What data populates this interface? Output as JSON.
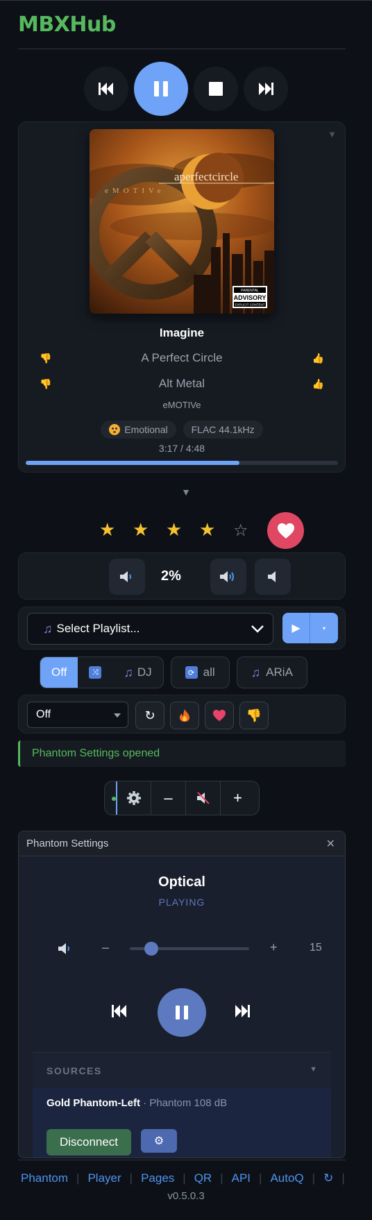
{
  "app": {
    "title": "MBXHub"
  },
  "transport": {
    "prev_icon": "skip-back-icon",
    "pause_icon": "pause-icon",
    "stop_icon": "stop-icon",
    "next_icon": "skip-forward-icon"
  },
  "now_playing": {
    "collapse_icon": "caret-down-icon",
    "album_art": {
      "band_text": "aperfectcircle",
      "album_text": "eMOTIVe",
      "label_top": "PARENTAL",
      "label_mid": "ADVISORY",
      "label_bottom": "EXPLICIT CONTENT"
    },
    "title": "Imagine",
    "artist": "A Perfect Circle",
    "genre": "Alt Metal",
    "album": "eMOTIVe",
    "mood_badge": "Emotional",
    "format_badge": "FLAC 44.1kHz",
    "time": "3:17 / 4:48",
    "progress": 0.685
  },
  "expand_caret": "▼",
  "rating": {
    "value": 4,
    "max": 5,
    "loved": true,
    "full_star": "★",
    "empty_star": "☆"
  },
  "volume": {
    "value": "2%"
  },
  "playlist": {
    "placeholder": "Select Playlist...",
    "play_icon": "▶",
    "dropdown_icon": "▾"
  },
  "modes": {
    "shuffle_segment": [
      "Off",
      "",
      "DJ"
    ],
    "repeat_label": "all",
    "aria_label": "ARiA"
  },
  "dj": {
    "select_value": "Off",
    "refresh_icon": "↻"
  },
  "alert": {
    "text": "Phantom Settings opened"
  },
  "mini_controls": {
    "minus": "–",
    "plus": "+"
  },
  "phantom": {
    "header": "Phantom Settings",
    "close": "✕",
    "device": "Optical",
    "status": "PLAYING",
    "volume_minus": "–",
    "volume_plus": "+",
    "volume_value": "15",
    "volume_fraction": 0.18,
    "sources_label": "SOURCES",
    "sources_caret": "▼",
    "source_name": "Gold Phantom-Left",
    "source_detail": " · Phantom 108 dB",
    "disconnect_label": "Disconnect",
    "gear_icon": "⚙"
  },
  "footer": {
    "links": [
      "Phantom",
      "Player",
      "Pages",
      "QR",
      "API",
      "AutoQ"
    ],
    "refresh_icon": "↻",
    "separator": "|",
    "version": "v0.5.0.3"
  },
  "colors": {
    "accent": "#6ea3f7",
    "brand": "#57b95e",
    "love": "#e04763",
    "phantom_accent": "#5d79bf"
  }
}
